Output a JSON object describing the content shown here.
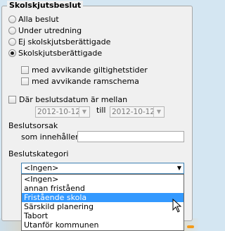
{
  "legend": "Skolskjutsbeslut",
  "radios": [
    {
      "label": "Alla beslut",
      "checked": false
    },
    {
      "label": "Under utredning",
      "checked": false
    },
    {
      "label": "Ej skolskjutsberättigade",
      "checked": false
    },
    {
      "label": "Skolskjutsberättigade",
      "checked": true
    }
  ],
  "checkboxes": {
    "giltighetstider": "med avvikande giltighetstider",
    "ramschema": "med avvikande ramschema",
    "datum": "Där beslutsdatum är mellan"
  },
  "dates": {
    "from": "2012-10-12",
    "to_label": "till",
    "to": "2012-10-12"
  },
  "beslutsorsak": {
    "label": "Beslutsorsak",
    "sublabel": "som innehåller",
    "value": ""
  },
  "beslutskategori": {
    "label": "Beslutskategori",
    "selected": "<Ingen>",
    "options": [
      "<Ingen>",
      "annan friståend",
      "Fristående skola",
      "Särskild planering",
      "Tabort",
      "Utanför kommunen"
    ],
    "highlighted_index": 2
  }
}
